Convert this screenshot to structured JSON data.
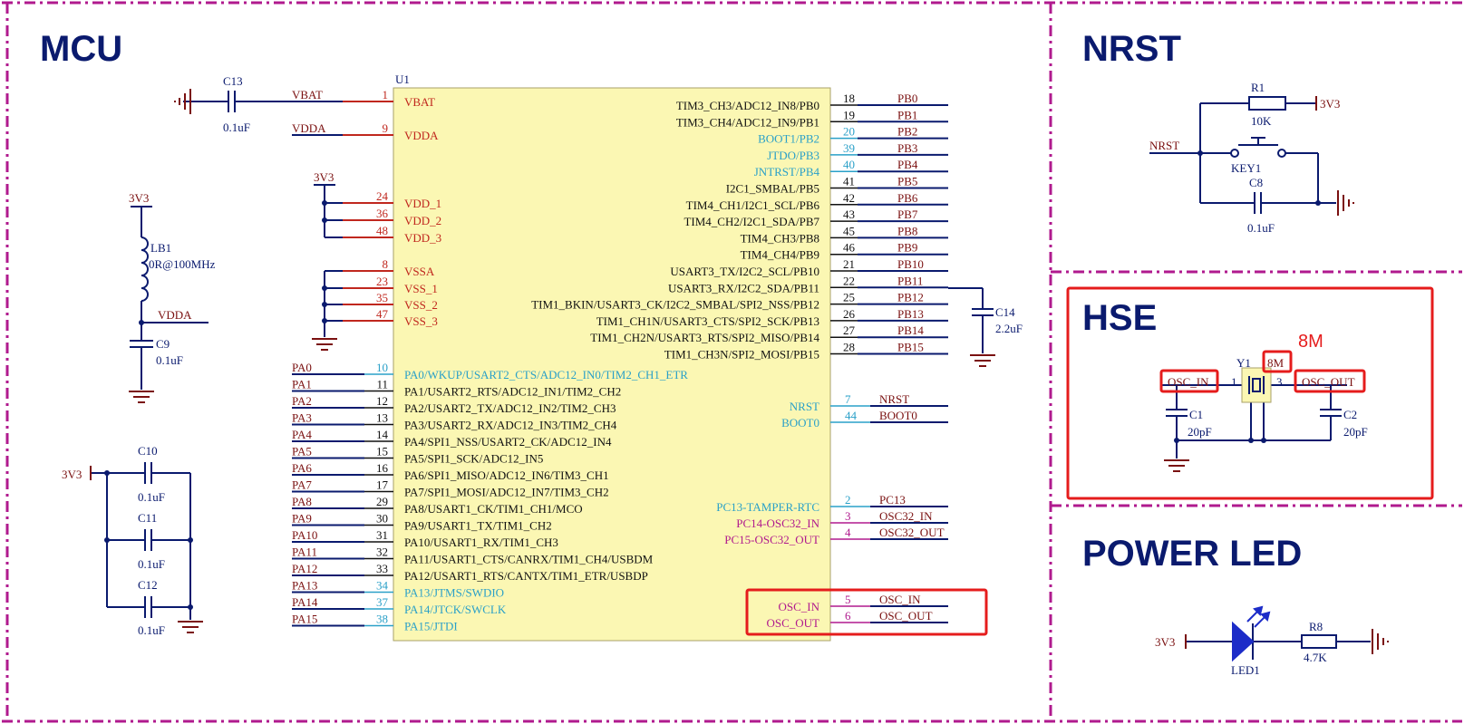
{
  "sections": {
    "mcu": "MCU",
    "nrst": "NRST",
    "hse": "HSE",
    "power_led": "POWER LED"
  },
  "annotation": "8M",
  "u1": {
    "ref": "U1"
  },
  "mcu_block": {
    "c13": {
      "ref": "C13",
      "value": "0.1uF"
    },
    "vbat_net": "VBAT",
    "vdda_net": "VDDA",
    "pwr3v3": "3V3",
    "lb1": {
      "ref": "LB1",
      "value": "0R@100MHz"
    },
    "lb_vdda": "VDDA",
    "lb_3v3": "3V3",
    "c9": {
      "ref": "C9",
      "value": "0.1uF"
    },
    "c10": {
      "ref": "C10",
      "value": "0.1uF"
    },
    "c11": {
      "ref": "C11",
      "value": "0.1uF"
    },
    "c12": {
      "ref": "C12",
      "value": "0.1uF"
    },
    "decap_3v3": "3V3",
    "c14": {
      "ref": "C14",
      "value": "2.2uF"
    }
  },
  "left_power": [
    {
      "num": "1",
      "name": "VBAT"
    },
    {
      "num": "9",
      "name": "VDDA"
    },
    {
      "num": "24",
      "name": "VDD_1"
    },
    {
      "num": "36",
      "name": "VDD_2"
    },
    {
      "num": "48",
      "name": "VDD_3"
    },
    {
      "num": "8",
      "name": "VSSA"
    },
    {
      "num": "23",
      "name": "VSS_1"
    },
    {
      "num": "35",
      "name": "VSS_2"
    },
    {
      "num": "47",
      "name": "VSS_3"
    }
  ],
  "left_pa": [
    {
      "net": "PA0",
      "num": "10",
      "name": "PA0/WKUP/USART2_CTS/ADC12_IN0/TIM2_CH1_ETR"
    },
    {
      "net": "PA1",
      "num": "11",
      "name": "PA1/USART2_RTS/ADC12_IN1/TIM2_CH2"
    },
    {
      "net": "PA2",
      "num": "12",
      "name": "PA2/USART2_TX/ADC12_IN2/TIM2_CH3"
    },
    {
      "net": "PA3",
      "num": "13",
      "name": "PA3/USART2_RX/ADC12_IN3/TIM2_CH4"
    },
    {
      "net": "PA4",
      "num": "14",
      "name": "PA4/SPI1_NSS/USART2_CK/ADC12_IN4"
    },
    {
      "net": "PA5",
      "num": "15",
      "name": "PA5/SPI1_SCK/ADC12_IN5"
    },
    {
      "net": "PA6",
      "num": "16",
      "name": "PA6/SPI1_MISO/ADC12_IN6/TIM3_CH1"
    },
    {
      "net": "PA7",
      "num": "17",
      "name": "PA7/SPI1_MOSI/ADC12_IN7/TIM3_CH2"
    },
    {
      "net": "PA8",
      "num": "29",
      "name": "PA8/USART1_CK/TIM1_CH1/MCO"
    },
    {
      "net": "PA9",
      "num": "30",
      "name": "PA9/USART1_TX/TIM1_CH2"
    },
    {
      "net": "PA10",
      "num": "31",
      "name": "PA10/USART1_RX/TIM1_CH3"
    },
    {
      "net": "PA11",
      "num": "32",
      "name": "PA11/USART1_CTS/CANRX/TIM1_CH4/USBDM"
    },
    {
      "net": "PA12",
      "num": "33",
      "name": "PA12/USART1_RTS/CANTX/TIM1_ETR/USBDP"
    },
    {
      "net": "PA13",
      "num": "34",
      "name": "PA13/JTMS/SWDIO"
    },
    {
      "net": "PA14",
      "num": "37",
      "name": "PA14/JTCK/SWCLK"
    },
    {
      "net": "PA15",
      "num": "38",
      "name": "PA15/JTDI"
    }
  ],
  "right_pb": [
    {
      "name": "TIM3_CH3/ADC12_IN8/PB0",
      "num": "18",
      "net": "PB0"
    },
    {
      "name": "TIM3_CH4/ADC12_IN9/PB1",
      "num": "19",
      "net": "PB1"
    },
    {
      "name": "BOOT1/PB2",
      "num": "20",
      "net": "PB2"
    },
    {
      "name": "JTDO/PB3",
      "num": "39",
      "net": "PB3"
    },
    {
      "name": "JNTRST/PB4",
      "num": "40",
      "net": "PB4"
    },
    {
      "name": "I2C1_SMBAL/PB5",
      "num": "41",
      "net": "PB5"
    },
    {
      "name": "TIM4_CH1/I2C1_SCL/PB6",
      "num": "42",
      "net": "PB6"
    },
    {
      "name": "TIM4_CH2/I2C1_SDA/PB7",
      "num": "43",
      "net": "PB7"
    },
    {
      "name": "TIM4_CH3/PB8",
      "num": "45",
      "net": "PB8"
    },
    {
      "name": "TIM4_CH4/PB9",
      "num": "46",
      "net": "PB9"
    },
    {
      "name": "USART3_TX/I2C2_SCL/PB10",
      "num": "21",
      "net": "PB10"
    },
    {
      "name": "USART3_RX/I2C2_SDA/PB11",
      "num": "22",
      "net": "PB11"
    },
    {
      "name": "TIM1_BKIN/USART3_CK/I2C2_SMBAL/SPI2_NSS/PB12",
      "num": "25",
      "net": "PB12"
    },
    {
      "name": "TIM1_CH1N/USART3_CTS/SPI2_SCK/PB13",
      "num": "26",
      "net": "PB13"
    },
    {
      "name": "TIM1_CH2N/USART3_RTS/SPI2_MISO/PB14",
      "num": "27",
      "net": "PB14"
    },
    {
      "name": "TIM1_CH3N/SPI2_MOSI/PB15",
      "num": "28",
      "net": "PB15"
    }
  ],
  "right_misc": [
    {
      "name": "NRST",
      "num": "7",
      "net": "NRST"
    },
    {
      "name": "BOOT0",
      "num": "44",
      "net": "BOOT0"
    },
    {
      "name": "PC13-TAMPER-RTC",
      "num": "2",
      "net": "PC13"
    },
    {
      "name": "PC14-OSC32_IN",
      "num": "3",
      "net": "OSC32_IN"
    },
    {
      "name": "PC15-OSC32_OUT",
      "num": "4",
      "net": "OSC32_OUT"
    },
    {
      "name": "OSC_IN",
      "num": "5",
      "net": "OSC_IN"
    },
    {
      "name": "OSC_OUT",
      "num": "6",
      "net": "OSC_OUT"
    }
  ],
  "nrst_block": {
    "r1": {
      "ref": "R1",
      "value": "10K"
    },
    "pwr": "3V3",
    "net": "NRST",
    "key": "KEY1",
    "c8": {
      "ref": "C8",
      "value": "0.1uF"
    }
  },
  "hse_block": {
    "y1": "Y1",
    "freq": "8M",
    "osc_in": "OSC_IN",
    "osc_out": "OSC_OUT",
    "pin1": "1",
    "pin3": "3",
    "c1": {
      "ref": "C1",
      "value": "20pF"
    },
    "c2": {
      "ref": "C2",
      "value": "20pF"
    }
  },
  "led_block": {
    "pwr": "3V3",
    "led": "LED1",
    "r8": {
      "ref": "R8",
      "value": "4.7K"
    }
  },
  "colors": {
    "border": "#b01a8e",
    "wire": "#0a1a6e",
    "pin_red": "#c0271e",
    "pin_blue": "#2aa0c8",
    "chip_fill": "#fbf7b3",
    "ground": "#7a1010",
    "highlight": "#e51c1c"
  }
}
